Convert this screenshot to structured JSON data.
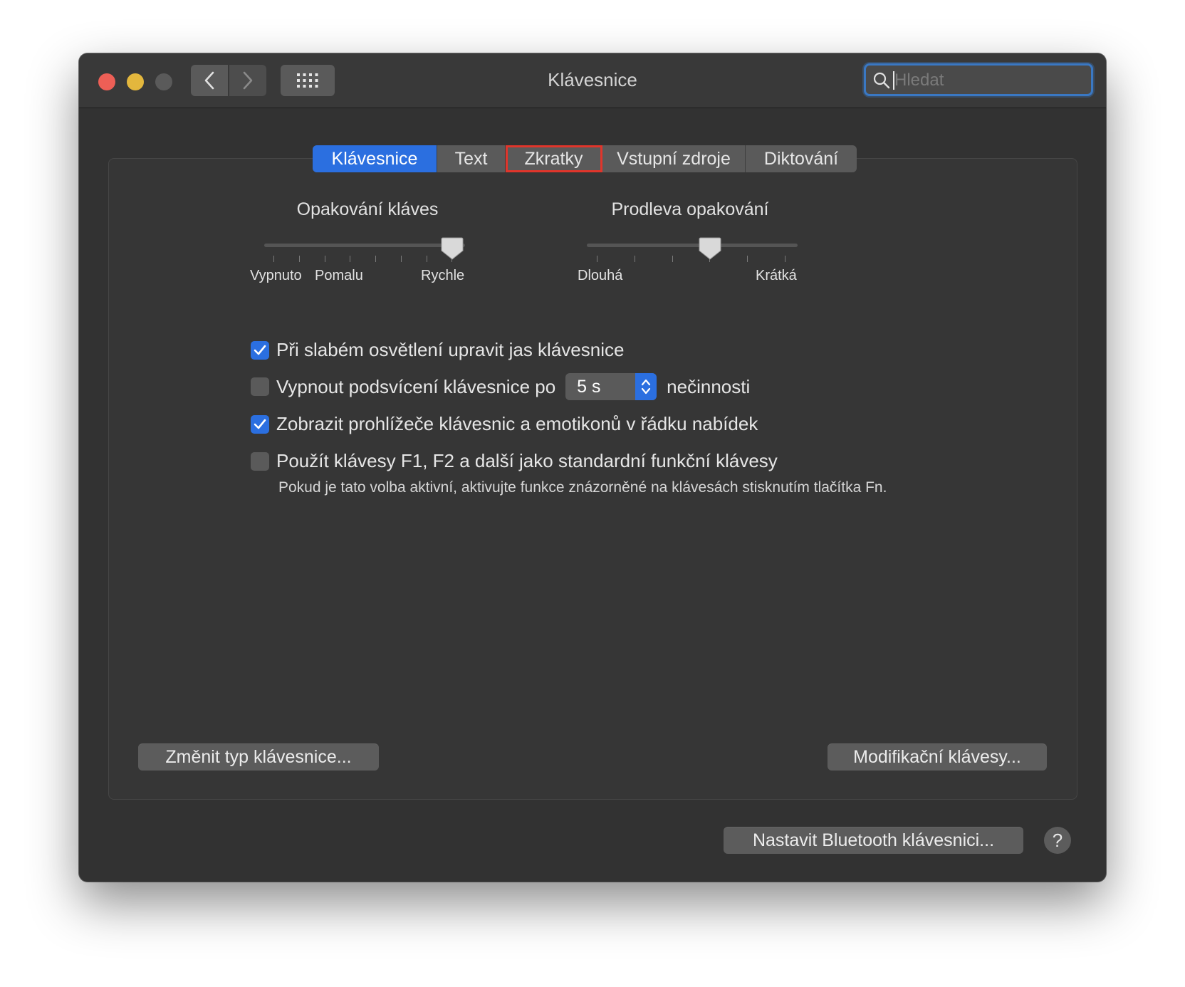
{
  "window": {
    "title": "Klávesnice"
  },
  "search": {
    "placeholder": "Hledat"
  },
  "tabs": [
    {
      "label": "Klávesnice",
      "active": true
    },
    {
      "label": "Text"
    },
    {
      "label": "Zkratky",
      "highlighted": true
    },
    {
      "label": "Vstupní zdroje"
    },
    {
      "label": "Diktování"
    }
  ],
  "key_repeat": {
    "title": "Opakování kláves",
    "labels": {
      "off": "Vypnuto",
      "slow": "Pomalu",
      "fast": "Rychle"
    },
    "value_fraction": 0.93
  },
  "repeat_delay": {
    "title": "Prodleva opakování",
    "labels": {
      "long": "Dlouhá",
      "short": "Krátká"
    },
    "value_fraction": 0.6
  },
  "options": [
    {
      "label": "Při slabém osvětlení upravit jas klávesnice",
      "checked": true
    },
    {
      "label": "Vypnout podsvícení klávesnice po",
      "checked": false,
      "stepper_value": "5 s",
      "suffix": "nečinnosti"
    },
    {
      "label": "Zobrazit prohlížeče klávesnic a emotikonů v řádku nabídek",
      "checked": true
    },
    {
      "label": "Použít klávesy F1, F2 a další jako standardní funkční klávesy",
      "checked": false,
      "note": "Pokud je tato volba aktivní, aktivujte funkce znázorněné na klávesách stisknutím tlačítka Fn."
    }
  ],
  "buttons": {
    "change_type": "Změnit typ klávesnice...",
    "modifier_keys": "Modifikační klávesy...",
    "bluetooth": "Nastavit Bluetooth klávesnici...",
    "help": "?"
  },
  "colors": {
    "accent": "#2b6fe0",
    "highlight_box": "#e1352b",
    "close": "#ed5f56",
    "minimize": "#e3b73d"
  }
}
